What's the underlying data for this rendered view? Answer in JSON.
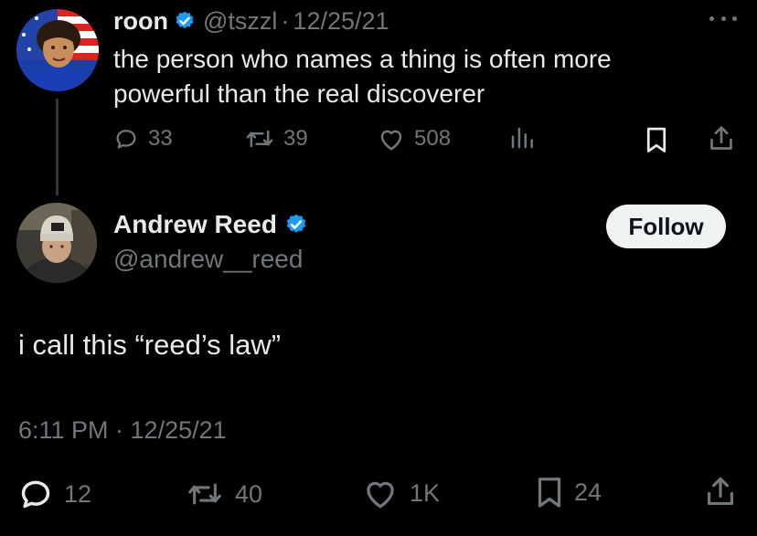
{
  "parent_tweet": {
    "name": "roon",
    "handle": "@tszzl",
    "separator": "·",
    "date": "12/25/21",
    "text": "the person who names a thing is often more powerful than the real discoverer",
    "stats": {
      "replies": "33",
      "retweets": "39",
      "likes": "508"
    }
  },
  "main_tweet": {
    "name": "Andrew Reed",
    "handle": "@andrew__reed",
    "follow_label": "Follow",
    "text": "i call this “reed’s law”",
    "timestamp": "6:11 PM · 12/25/21",
    "stats": {
      "replies": "12",
      "retweets": "40",
      "likes": "1K",
      "bookmarks": "24"
    }
  },
  "colors": {
    "background": "#000000",
    "text_primary": "#e7e9ea",
    "text_secondary": "#71767b",
    "verified_blue": "#1d9bf0",
    "follow_button_bg": "#eff3f4",
    "follow_button_text": "#0f1419"
  },
  "icons": {
    "verified": "verified-badge-icon",
    "reply": "reply-icon",
    "retweet": "retweet-icon",
    "like": "heart-icon",
    "views": "analytics-icon",
    "bookmark": "bookmark-icon",
    "share": "share-icon",
    "more": "more-icon"
  }
}
